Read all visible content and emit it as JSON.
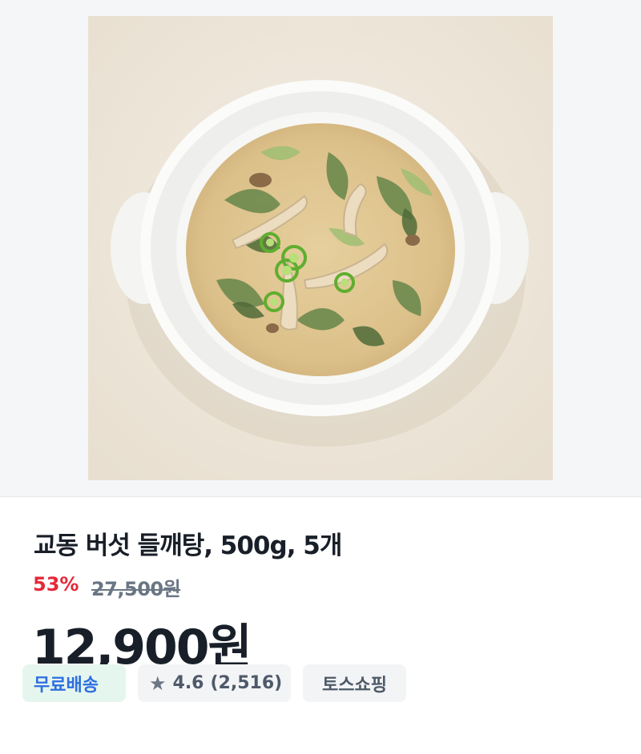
{
  "product": {
    "image_alt": "교동 버섯 들깨탕 제품 이미지",
    "title": "교동 버섯 들깨탕, 500g, 5개",
    "discount": "53%",
    "original_price": "27,500원",
    "price": "12,900원"
  },
  "tags": {
    "shipping": "무료배송",
    "rating_icon": "star-icon",
    "rating": "4.6",
    "review_count": "(2,516)",
    "store": "토스쇼핑"
  },
  "colors": {
    "discount": "#e42939",
    "shipping_text": "#2d6ee0",
    "shipping_bg": "#e5f6ee",
    "tag_bg": "#f2f4f6"
  }
}
